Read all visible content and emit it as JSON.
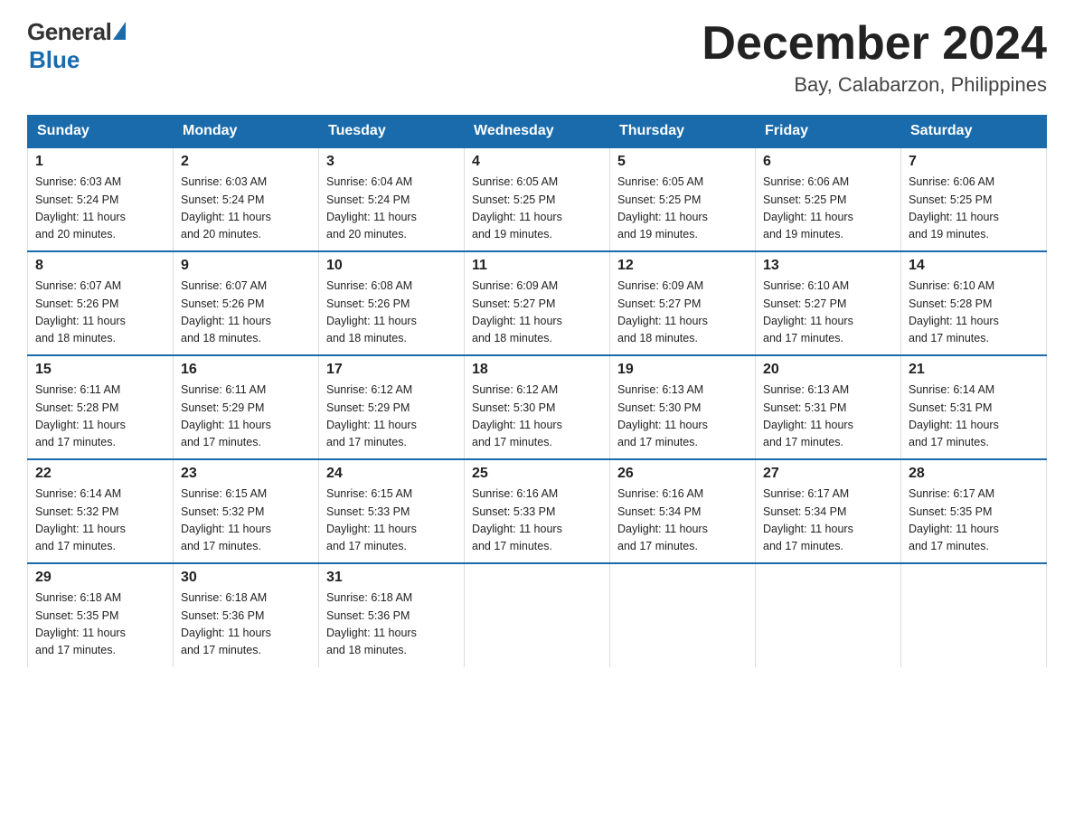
{
  "header": {
    "logo_general": "General",
    "logo_blue": "Blue",
    "month_title": "December 2024",
    "subtitle": "Bay, Calabarzon, Philippines"
  },
  "days_of_week": [
    "Sunday",
    "Monday",
    "Tuesday",
    "Wednesday",
    "Thursday",
    "Friday",
    "Saturday"
  ],
  "weeks": [
    [
      {
        "day": "1",
        "info": "Sunrise: 6:03 AM\nSunset: 5:24 PM\nDaylight: 11 hours\nand 20 minutes."
      },
      {
        "day": "2",
        "info": "Sunrise: 6:03 AM\nSunset: 5:24 PM\nDaylight: 11 hours\nand 20 minutes."
      },
      {
        "day": "3",
        "info": "Sunrise: 6:04 AM\nSunset: 5:24 PM\nDaylight: 11 hours\nand 20 minutes."
      },
      {
        "day": "4",
        "info": "Sunrise: 6:05 AM\nSunset: 5:25 PM\nDaylight: 11 hours\nand 19 minutes."
      },
      {
        "day": "5",
        "info": "Sunrise: 6:05 AM\nSunset: 5:25 PM\nDaylight: 11 hours\nand 19 minutes."
      },
      {
        "day": "6",
        "info": "Sunrise: 6:06 AM\nSunset: 5:25 PM\nDaylight: 11 hours\nand 19 minutes."
      },
      {
        "day": "7",
        "info": "Sunrise: 6:06 AM\nSunset: 5:25 PM\nDaylight: 11 hours\nand 19 minutes."
      }
    ],
    [
      {
        "day": "8",
        "info": "Sunrise: 6:07 AM\nSunset: 5:26 PM\nDaylight: 11 hours\nand 18 minutes."
      },
      {
        "day": "9",
        "info": "Sunrise: 6:07 AM\nSunset: 5:26 PM\nDaylight: 11 hours\nand 18 minutes."
      },
      {
        "day": "10",
        "info": "Sunrise: 6:08 AM\nSunset: 5:26 PM\nDaylight: 11 hours\nand 18 minutes."
      },
      {
        "day": "11",
        "info": "Sunrise: 6:09 AM\nSunset: 5:27 PM\nDaylight: 11 hours\nand 18 minutes."
      },
      {
        "day": "12",
        "info": "Sunrise: 6:09 AM\nSunset: 5:27 PM\nDaylight: 11 hours\nand 18 minutes."
      },
      {
        "day": "13",
        "info": "Sunrise: 6:10 AM\nSunset: 5:27 PM\nDaylight: 11 hours\nand 17 minutes."
      },
      {
        "day": "14",
        "info": "Sunrise: 6:10 AM\nSunset: 5:28 PM\nDaylight: 11 hours\nand 17 minutes."
      }
    ],
    [
      {
        "day": "15",
        "info": "Sunrise: 6:11 AM\nSunset: 5:28 PM\nDaylight: 11 hours\nand 17 minutes."
      },
      {
        "day": "16",
        "info": "Sunrise: 6:11 AM\nSunset: 5:29 PM\nDaylight: 11 hours\nand 17 minutes."
      },
      {
        "day": "17",
        "info": "Sunrise: 6:12 AM\nSunset: 5:29 PM\nDaylight: 11 hours\nand 17 minutes."
      },
      {
        "day": "18",
        "info": "Sunrise: 6:12 AM\nSunset: 5:30 PM\nDaylight: 11 hours\nand 17 minutes."
      },
      {
        "day": "19",
        "info": "Sunrise: 6:13 AM\nSunset: 5:30 PM\nDaylight: 11 hours\nand 17 minutes."
      },
      {
        "day": "20",
        "info": "Sunrise: 6:13 AM\nSunset: 5:31 PM\nDaylight: 11 hours\nand 17 minutes."
      },
      {
        "day": "21",
        "info": "Sunrise: 6:14 AM\nSunset: 5:31 PM\nDaylight: 11 hours\nand 17 minutes."
      }
    ],
    [
      {
        "day": "22",
        "info": "Sunrise: 6:14 AM\nSunset: 5:32 PM\nDaylight: 11 hours\nand 17 minutes."
      },
      {
        "day": "23",
        "info": "Sunrise: 6:15 AM\nSunset: 5:32 PM\nDaylight: 11 hours\nand 17 minutes."
      },
      {
        "day": "24",
        "info": "Sunrise: 6:15 AM\nSunset: 5:33 PM\nDaylight: 11 hours\nand 17 minutes."
      },
      {
        "day": "25",
        "info": "Sunrise: 6:16 AM\nSunset: 5:33 PM\nDaylight: 11 hours\nand 17 minutes."
      },
      {
        "day": "26",
        "info": "Sunrise: 6:16 AM\nSunset: 5:34 PM\nDaylight: 11 hours\nand 17 minutes."
      },
      {
        "day": "27",
        "info": "Sunrise: 6:17 AM\nSunset: 5:34 PM\nDaylight: 11 hours\nand 17 minutes."
      },
      {
        "day": "28",
        "info": "Sunrise: 6:17 AM\nSunset: 5:35 PM\nDaylight: 11 hours\nand 17 minutes."
      }
    ],
    [
      {
        "day": "29",
        "info": "Sunrise: 6:18 AM\nSunset: 5:35 PM\nDaylight: 11 hours\nand 17 minutes."
      },
      {
        "day": "30",
        "info": "Sunrise: 6:18 AM\nSunset: 5:36 PM\nDaylight: 11 hours\nand 17 minutes."
      },
      {
        "day": "31",
        "info": "Sunrise: 6:18 AM\nSunset: 5:36 PM\nDaylight: 11 hours\nand 18 minutes."
      },
      null,
      null,
      null,
      null
    ]
  ]
}
